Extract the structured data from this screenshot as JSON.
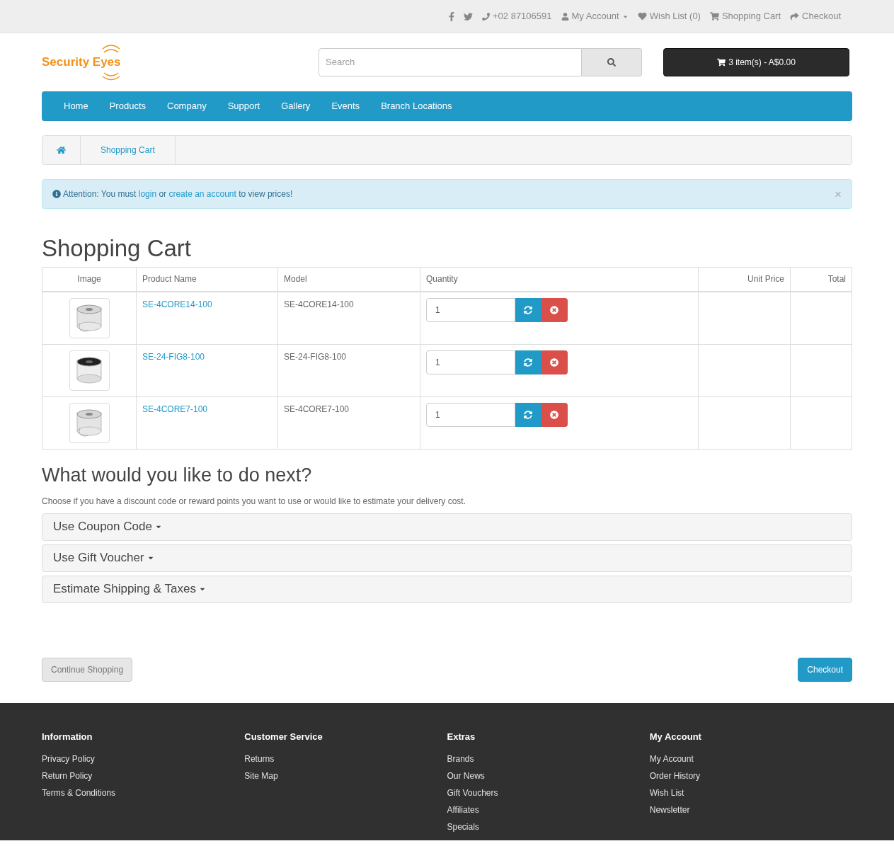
{
  "top_bar": {
    "phone": "+02 87106591",
    "my_account": "My Account",
    "wish_list": "Wish List (0)",
    "shopping_cart": "Shopping Cart",
    "checkout": "Checkout"
  },
  "logo": {
    "text": "Security Eyes"
  },
  "search": {
    "placeholder": "Search"
  },
  "cart_button": {
    "label": "3 item(s) - A$0.00"
  },
  "nav": [
    "Home",
    "Products",
    "Company",
    "Support",
    "Gallery",
    "Events",
    "Branch Locations"
  ],
  "breadcrumb": [
    "Shopping Cart"
  ],
  "alert": {
    "parts": [
      {
        "kind": "text",
        "text": "Attention: You must "
      },
      {
        "kind": "link",
        "text": "login"
      },
      {
        "kind": "text",
        "text": " or "
      },
      {
        "kind": "link",
        "text": "create an account"
      },
      {
        "kind": "text",
        "text": " to view prices!"
      }
    ],
    "close": "×"
  },
  "title": "Shopping Cart",
  "table": {
    "columns": [
      "Image",
      "Product Name",
      "Model",
      "Quantity",
      "Unit Price",
      "Total"
    ],
    "rows": [
      {
        "kind": "light",
        "name": "SE-4CORE14-100",
        "model": "SE-4CORE14-100",
        "quantity": "1"
      },
      {
        "kind": "dark",
        "name": "SE-24-FIG8-100",
        "model": "SE-24-FIG8-100",
        "quantity": "1"
      },
      {
        "kind": "light",
        "name": "SE-4CORE7-100",
        "model": "SE-4CORE7-100",
        "quantity": "1"
      }
    ]
  },
  "next": {
    "title": "What would you like to do next?",
    "text": "Choose if you have a discount code or reward points you want to use or would like to estimate your delivery cost.",
    "panels": [
      "Use Coupon Code",
      "Use Gift Voucher",
      "Estimate Shipping & Taxes"
    ]
  },
  "buttons": {
    "continue": "Continue Shopping",
    "checkout": "Checkout"
  },
  "footer": [
    {
      "title": "Information",
      "links": [
        "Privacy Policy",
        "Return Policy",
        "Terms & Conditions"
      ]
    },
    {
      "title": "Customer Service",
      "links": [
        "Returns",
        "Site Map"
      ]
    },
    {
      "title": "Extras",
      "links": [
        "Brands",
        "Our News",
        "Gift Vouchers",
        "Affiliates",
        "Specials"
      ]
    },
    {
      "title": "My Account",
      "links": [
        "My Account",
        "Order History",
        "Wish List",
        "Newsletter"
      ]
    }
  ]
}
